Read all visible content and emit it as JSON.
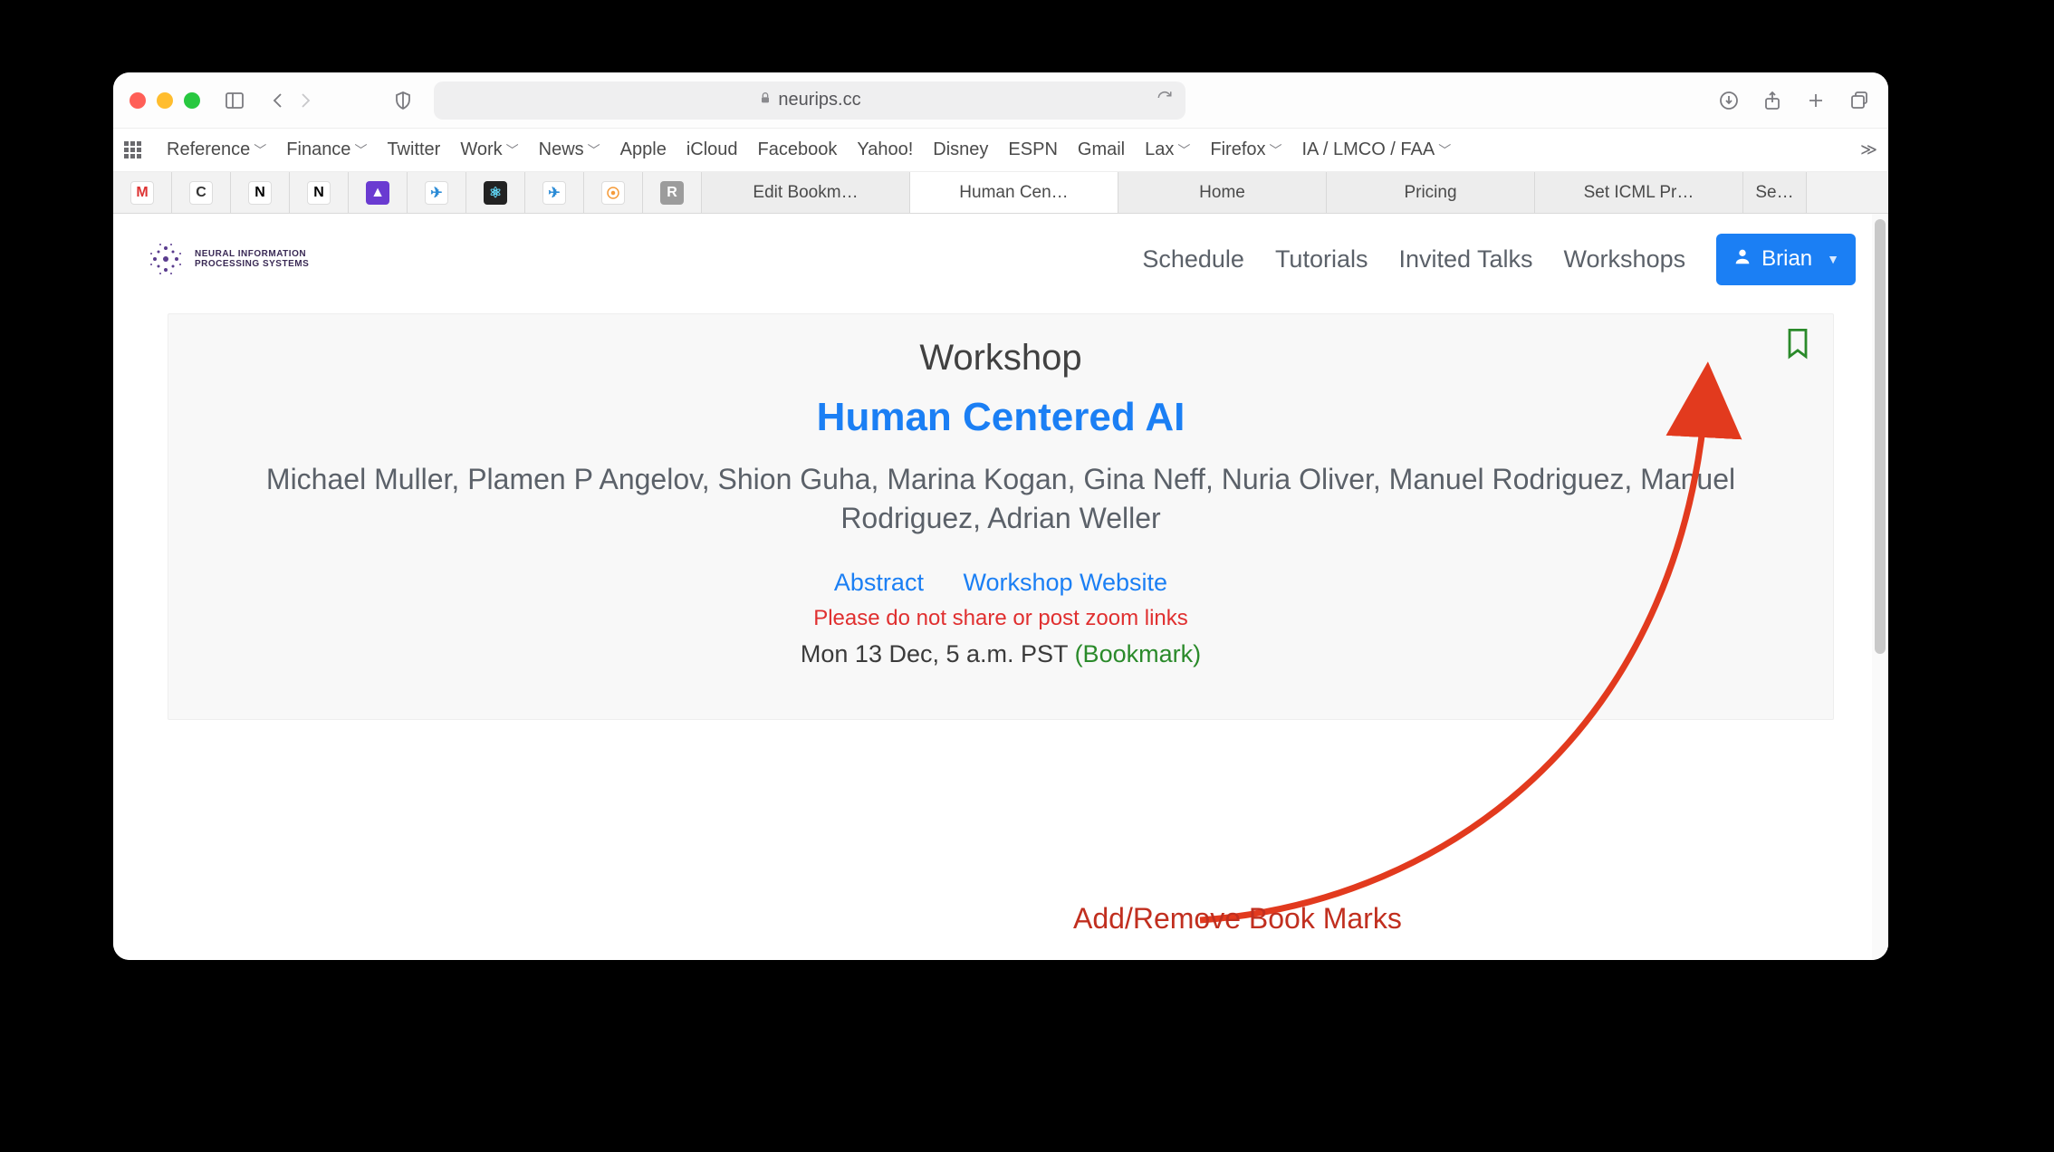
{
  "browser": {
    "url_host": "neurips.cc",
    "favorites": [
      {
        "label": "Reference",
        "dropdown": true
      },
      {
        "label": "Finance",
        "dropdown": true
      },
      {
        "label": "Twitter",
        "dropdown": false
      },
      {
        "label": "Work",
        "dropdown": true
      },
      {
        "label": "News",
        "dropdown": true
      },
      {
        "label": "Apple",
        "dropdown": false
      },
      {
        "label": "iCloud",
        "dropdown": false
      },
      {
        "label": "Facebook",
        "dropdown": false
      },
      {
        "label": "Yahoo!",
        "dropdown": false
      },
      {
        "label": "Disney",
        "dropdown": false
      },
      {
        "label": "ESPN",
        "dropdown": false
      },
      {
        "label": "Gmail",
        "dropdown": false
      },
      {
        "label": "Lax",
        "dropdown": true
      },
      {
        "label": "Firefox",
        "dropdown": true
      },
      {
        "label": "IA / LMCO / FAA",
        "dropdown": true
      }
    ],
    "tabs": [
      {
        "label": "Edit Bookm…",
        "active": false
      },
      {
        "label": "Human Cen…",
        "active": true
      },
      {
        "label": "Home",
        "active": false
      },
      {
        "label": "Pricing",
        "active": false
      },
      {
        "label": "Set ICML Pr…",
        "active": false
      },
      {
        "label": "Se…",
        "active": false
      }
    ]
  },
  "site": {
    "logo_text": "NEURAL INFORMATION\nPROCESSING SYSTEMS",
    "nav": [
      "Schedule",
      "Tutorials",
      "Invited Talks",
      "Workshops"
    ],
    "user_name": "Brian"
  },
  "event": {
    "kind": "Workshop",
    "title": "Human Centered AI",
    "authors": "Michael Muller, Plamen P Angelov, Shion Guha, Marina Kogan, Gina Neff, Nuria Oliver, Manuel Rodriguez, Manuel Rodriguez, Adrian Weller",
    "links": {
      "abstract": "Abstract",
      "website": "Workshop Website"
    },
    "warning": "Please do not share or post zoom links",
    "datetime": "Mon 13 Dec, 5 a.m. PST",
    "bookmark_label": "(Bookmark)"
  },
  "annotation": {
    "label": "Add/Remove Book Marks"
  }
}
